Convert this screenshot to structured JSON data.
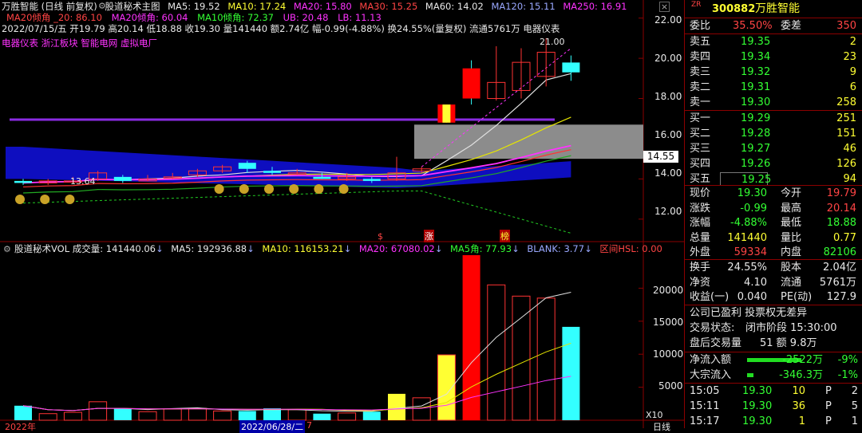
{
  "header": {
    "title": "万胜智能 (日线 前复权)",
    "indicator": "股道秘术主图",
    "ma5": "MA5: 19.52",
    "ma10": "MA10: 17.24",
    "ma20": "MA20: 15.80",
    "ma30": "MA30: 15.25",
    "ma60": "MA60: 14.02",
    "ma120": "MA120: 15.11",
    "ma250": "MA250: 16.91",
    "ma20_slope": "MA20倾角 _20: 86.10",
    "ma20_slope2": "MA20倾角: 60.04",
    "ma10_slope": "MA10倾角: 72.37",
    "ub": "UB: 20.48",
    "lb": "LB: 11.13",
    "date_line": "2022/07/15/五  开19.79 高20.14 低18.88 收19.30 量141440 额2.74亿 幅-0.99(-4.88%) 换24.55%(量复权) 流通5761万 电器仪表",
    "tags": "电器仪表 浙江板块 智能电网 虚拟电厂"
  },
  "price_axis": [
    "22.00",
    "20.00",
    "18.00",
    "16.00",
    "14.00",
    "12.00"
  ],
  "price_marker": "14.55",
  "annotations": {
    "high": "21.00",
    "low": "13.64",
    "s_mark": "$",
    "zhang": "涨",
    "bang": "榜"
  },
  "vol_header": {
    "name": "股道秘术VOL 成交量: 141440.06",
    "ma5": "MA5: 192936.88",
    "ma10": "MA10: 116153.21",
    "ma20": "MA20: 67080.02",
    "ma5a": "MA5角: 77.93",
    "blank": "BLANK: 3.77",
    "hsl": "区间HSL: 0.00"
  },
  "vol_axis": [
    "20000",
    "15000",
    "10000",
    "5000"
  ],
  "vol_unit": "X10",
  "bottom": {
    "year": "2022年",
    "date": "2022/06/28/二",
    "d": "7",
    "period": "日线"
  },
  "chart_data": {
    "type": "candlestick",
    "price_range": [
      11.0,
      22.9
    ],
    "candles": [
      {
        "o": 13.9,
        "c": 13.8,
        "h": 14.0,
        "l": 13.7
      },
      {
        "o": 13.8,
        "c": 13.9,
        "h": 14.0,
        "l": 13.7
      },
      {
        "o": 13.9,
        "c": 13.9,
        "h": 14.1,
        "l": 13.8
      },
      {
        "o": 14.0,
        "c": 14.3,
        "h": 14.4,
        "l": 13.9
      },
      {
        "o": 14.1,
        "c": 13.9,
        "h": 14.2,
        "l": 13.8
      },
      {
        "o": 13.9,
        "c": 14.0,
        "h": 14.2,
        "l": 13.9
      },
      {
        "o": 14.1,
        "c": 14.1,
        "h": 14.3,
        "l": 14.0
      },
      {
        "o": 14.2,
        "c": 14.4,
        "h": 14.5,
        "l": 14.1
      },
      {
        "o": 14.4,
        "c": 14.6,
        "h": 14.7,
        "l": 14.3
      },
      {
        "o": 14.8,
        "c": 14.5,
        "h": 14.9,
        "l": 14.3
      },
      {
        "o": 14.4,
        "c": 14.3,
        "h": 14.6,
        "l": 14.2
      },
      {
        "o": 14.3,
        "c": 14.3,
        "h": 14.5,
        "l": 14.2
      },
      {
        "o": 14.1,
        "c": 14.0,
        "h": 14.3,
        "l": 14.0
      },
      {
        "o": 14.0,
        "c": 14.1,
        "h": 14.3,
        "l": 13.9
      },
      {
        "o": 14.0,
        "c": 13.9,
        "h": 14.1,
        "l": 13.8
      },
      {
        "o": 14.0,
        "c": 14.3,
        "h": 15.1,
        "l": 13.9
      },
      {
        "o": 14.4,
        "c": 14.5,
        "h": 14.6,
        "l": 14.3
      },
      {
        "o": 16.8,
        "c": 17.7,
        "h": 17.7,
        "l": 16.8
      },
      {
        "o": 19.5,
        "c": 18.0,
        "h": 19.9,
        "l": 17.7
      },
      {
        "o": 18.0,
        "c": 18.8,
        "h": 20.6,
        "l": 17.9
      },
      {
        "o": 18.4,
        "c": 19.8,
        "h": 20.5,
        "l": 18.0
      },
      {
        "o": 19.1,
        "c": 20.3,
        "h": 21.0,
        "l": 18.6
      },
      {
        "o": 19.79,
        "c": 19.3,
        "h": 20.14,
        "l": 18.88
      }
    ],
    "volume_range": [
      0,
      25000
    ],
    "volume": [
      2200,
      1000,
      1200,
      2800,
      1800,
      1300,
      1700,
      1800,
      1400,
      1400,
      1800,
      1600,
      1000,
      1100,
      1300,
      4000,
      3400,
      9900,
      25000,
      20500,
      18800,
      18500,
      14144
    ]
  },
  "panel": {
    "code_prefix": "ZR",
    "code": "300882",
    "name": "万胜智能",
    "wb_label": "委比",
    "wb_value": "35.50%",
    "wc_label": "委差",
    "wc_value": "350",
    "asks": [
      {
        "label": "卖五",
        "price": "19.35",
        "vol": "2"
      },
      {
        "label": "卖四",
        "price": "19.34",
        "vol": "23"
      },
      {
        "label": "卖三",
        "price": "19.32",
        "vol": "9"
      },
      {
        "label": "卖二",
        "price": "19.31",
        "vol": "6"
      },
      {
        "label": "卖一",
        "price": "19.30",
        "vol": "258"
      }
    ],
    "bids": [
      {
        "label": "买一",
        "price": "19.29",
        "vol": "251"
      },
      {
        "label": "买二",
        "price": "19.28",
        "vol": "151"
      },
      {
        "label": "买三",
        "price": "19.27",
        "vol": "46"
      },
      {
        "label": "买四",
        "price": "19.26",
        "vol": "126"
      },
      {
        "label": "买五",
        "price": "19.25",
        "vol": "94"
      }
    ],
    "stats": [
      {
        "l1": "现价",
        "v1": "19.30",
        "c1": "green",
        "l2": "今开",
        "v2": "19.79",
        "c2": "red"
      },
      {
        "l1": "涨跌",
        "v1": "-0.99",
        "c1": "green",
        "l2": "最高",
        "v2": "20.14",
        "c2": "red"
      },
      {
        "l1": "涨幅",
        "v1": "-4.88%",
        "c1": "green",
        "l2": "最低",
        "v2": "18.88",
        "c2": "green"
      },
      {
        "l1": "总量",
        "v1": "141440",
        "c1": "yellow",
        "l2": "量比",
        "v2": "0.77",
        "c2": "yellow"
      },
      {
        "l1": "外盘",
        "v1": "59334",
        "c1": "red",
        "l2": "内盘",
        "v2": "82106",
        "c2": "green"
      }
    ],
    "stats2": [
      {
        "l1": "换手",
        "v1": "24.55%",
        "l2": "股本",
        "v2": "2.04亿"
      },
      {
        "l1": "净资",
        "v1": "4.10",
        "l2": "流通",
        "v2": "5761万"
      },
      {
        "l1": "收益(一)",
        "v1": "0.040",
        "l2": "PE(动)",
        "v2": "127.9"
      }
    ],
    "notice": "公司已盈利 投票权无差异",
    "trade_state_label": "交易状态:",
    "trade_state": "闭市阶段 15:30:00",
    "after_label": "盘后交易量",
    "after_value": "51 额 9.8万",
    "flow": [
      {
        "label": "净流入额",
        "value": "-2522万",
        "pct": "-9%"
      },
      {
        "label": "大宗流入",
        "value": "-346.3万",
        "pct": "-1%"
      }
    ],
    "ticks": [
      {
        "time": "15:05",
        "price": "19.30",
        "vol": "10",
        "flag": "P",
        "n": "2"
      },
      {
        "time": "15:11",
        "price": "19.30",
        "vol": "36",
        "flag": "P",
        "n": "5"
      },
      {
        "time": "15:17",
        "price": "19.30",
        "vol": "1",
        "flag": "P",
        "n": "1"
      }
    ]
  }
}
